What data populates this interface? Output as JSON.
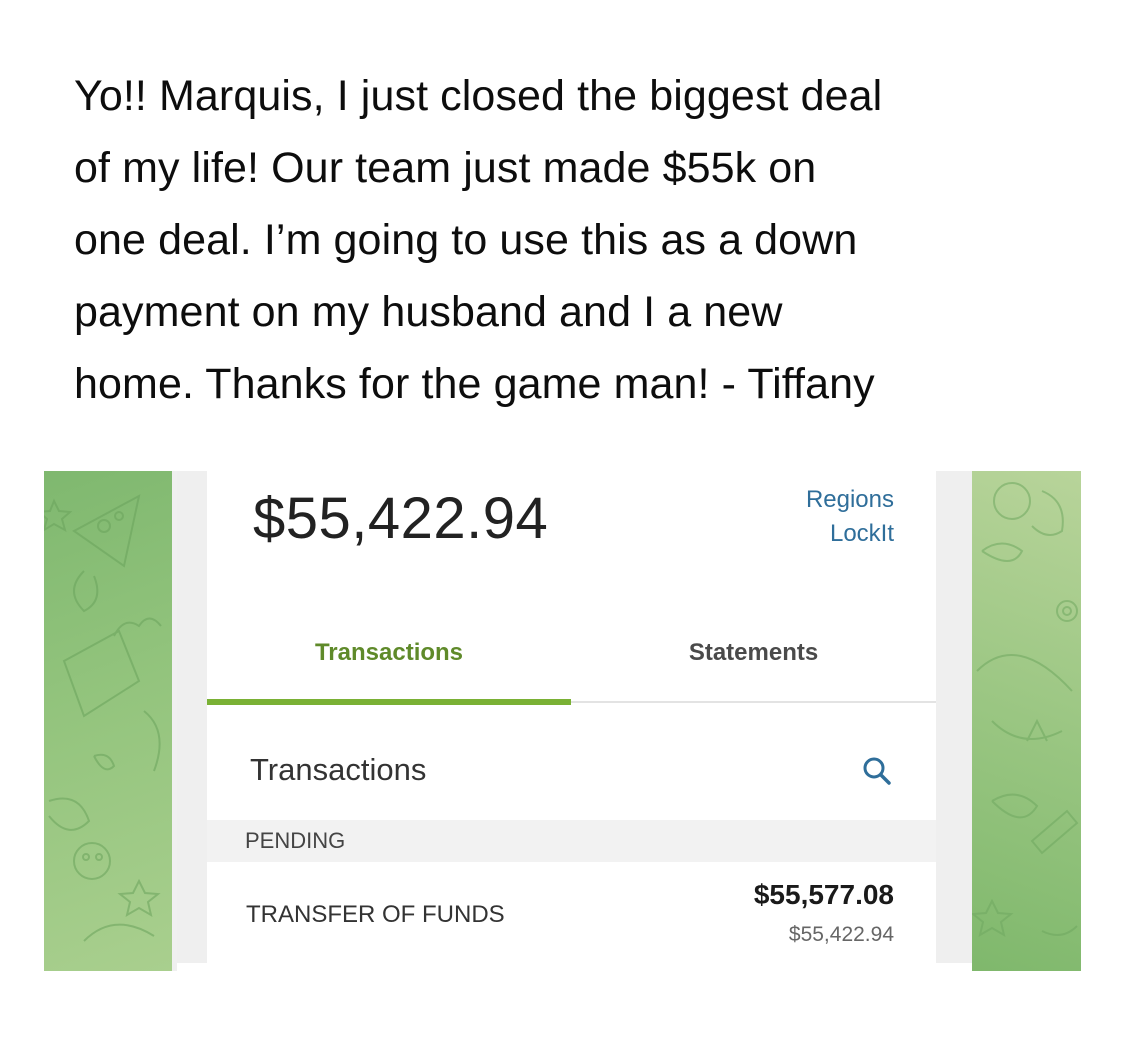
{
  "post": {
    "lines": [
      "Yo!! Marquis, I just closed the biggest deal",
      "of my life! Our team just made $55k on",
      "one deal. I’m going to use this as a down",
      "payment on my husband and I a new",
      "home. Thanks for the game man! - Tiffany"
    ]
  },
  "account": {
    "balance": "$55,422.94",
    "lockit_line1": "Regions",
    "lockit_line2": "LockIt"
  },
  "tabs": [
    {
      "label": "Transactions",
      "active": true
    },
    {
      "label": "Statements",
      "active": false
    }
  ],
  "transactions": {
    "title": "Transactions",
    "search_icon": "search-icon",
    "pending_label": "PENDING",
    "items": [
      {
        "description": "TRANSFER OF FUNDS",
        "amount": "$55,577.08",
        "running_balance": "$55,422.94"
      }
    ]
  },
  "colors": {
    "accent_green": "#7ab135",
    "tab_active_text": "#5f8a2a",
    "link_blue": "#2f6e9a",
    "wallpaper_green": "#93c47d"
  }
}
